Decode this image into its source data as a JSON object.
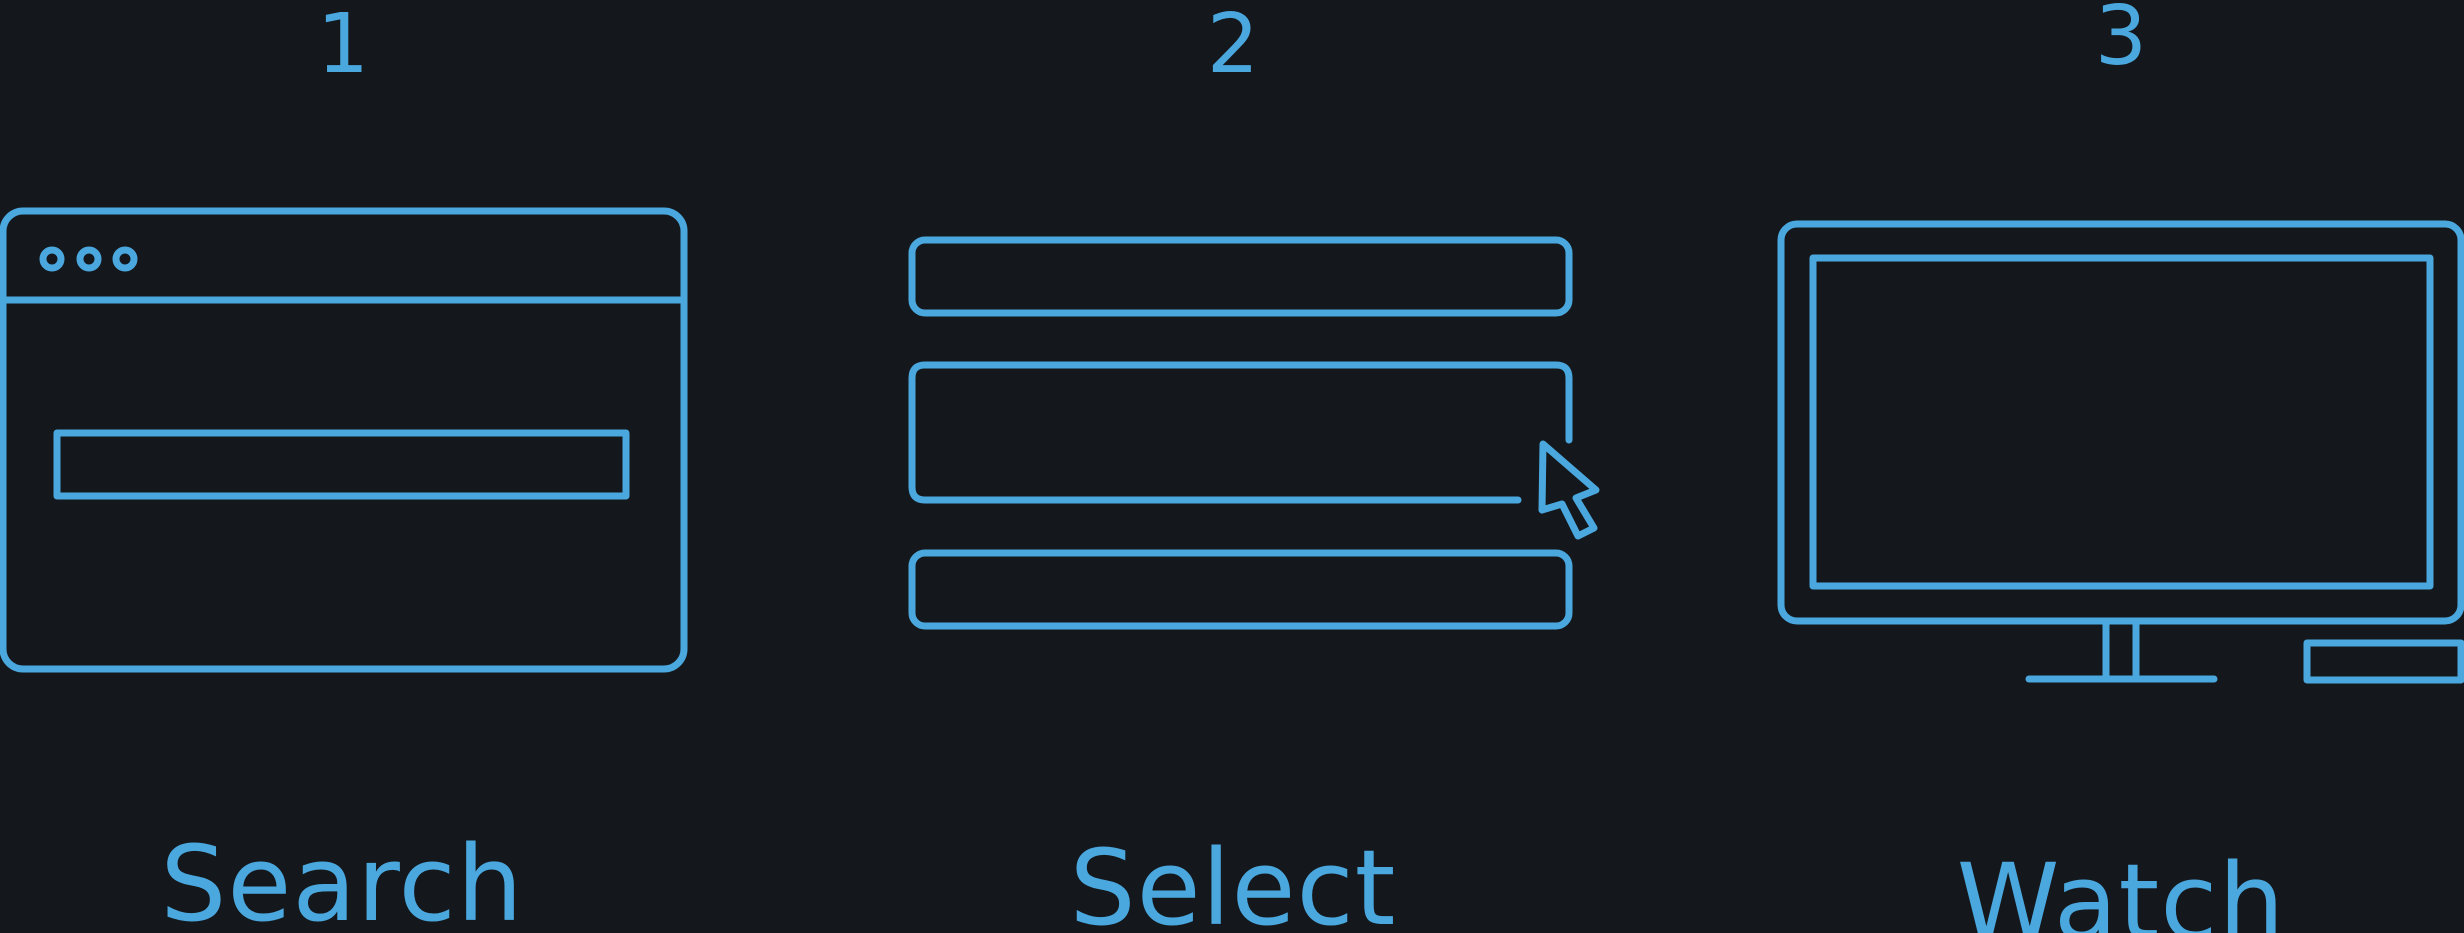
{
  "steps": [
    {
      "number": "1",
      "label": "Search",
      "icon": "browser-window-icon"
    },
    {
      "number": "2",
      "label": "Select",
      "icon": "list-with-cursor-icon"
    },
    {
      "number": "3",
      "label": "Watch",
      "icon": "tv-monitor-icon"
    }
  ],
  "colors": {
    "background": "#14171b",
    "accent": "#4aa8df"
  }
}
